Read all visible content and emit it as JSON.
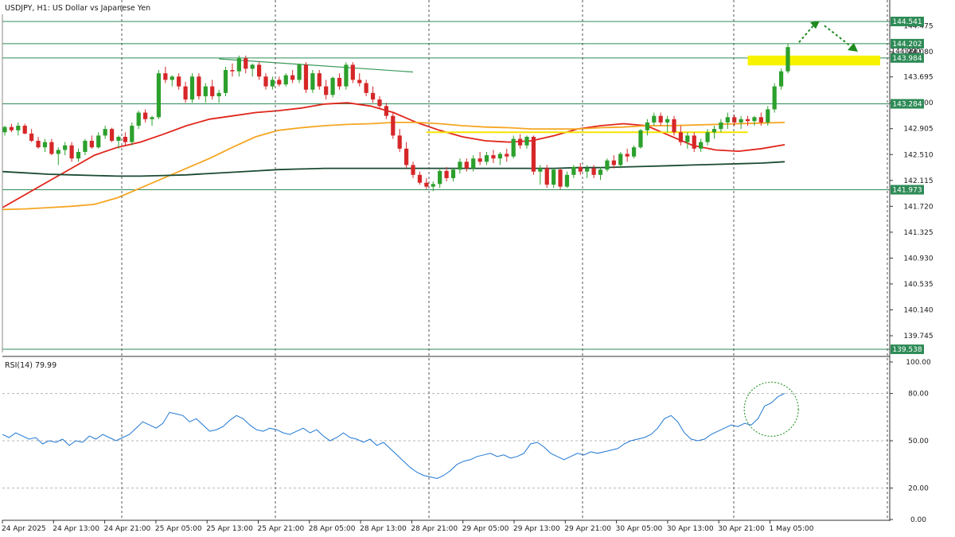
{
  "chart_title": "USDJPY, H1:  US Dollar vs Japanese Yen",
  "rsi_title": "RSI(14) 79.99",
  "colors": {
    "bull": "#2ca02c",
    "bear": "#d62728",
    "ma_red": "#e0251b",
    "ma_orange": "#f5a623",
    "ma_dark": "#1b4a33",
    "level_line": "#2e8b57",
    "highlight": "#f7f300",
    "rsi_line": "#1f77d4",
    "arrow": "#1e8a1e",
    "grid": "#555555"
  },
  "chart_data": {
    "type": "candlestick",
    "price_axis": {
      "ticks": [
        "144.475",
        "144.080",
        "143.695",
        "143.300",
        "142.905",
        "142.510",
        "142.115",
        "141.720",
        "141.325",
        "140.930",
        "140.535",
        "140.140",
        "139.745"
      ],
      "range": [
        139.49,
        144.65
      ]
    },
    "time_axis": {
      "ticks": [
        "24 Apr 2025",
        "24 Apr 13:00",
        "24 Apr 21:00",
        "25 Apr 05:00",
        "25 Apr 13:00",
        "25 Apr 21:00",
        "28 Apr 05:00",
        "28 Apr 13:00",
        "28 Apr 21:00",
        "29 Apr 05:00",
        "29 Apr 13:00",
        "29 Apr 21:00",
        "30 Apr 05:00",
        "30 Apr 13:00",
        "30 Apr 21:00",
        "1 May 05:00"
      ]
    },
    "horizontal_levels": [
      {
        "value": 144.541,
        "label": "144.541"
      },
      {
        "value": 144.202,
        "label": "144.202"
      },
      {
        "value": 143.984,
        "label": "143.984"
      },
      {
        "value": 143.284,
        "label": "143.284"
      },
      {
        "value": 141.973,
        "label": "141.973"
      },
      {
        "value": 139.538,
        "label": "139.538"
      }
    ],
    "extra_price_label": "144.090",
    "candles": [
      [
        142.85,
        142.95,
        142.8,
        142.93
      ],
      [
        142.93,
        142.98,
        142.85,
        142.88
      ],
      [
        142.88,
        143.0,
        142.8,
        142.95
      ],
      [
        142.95,
        142.98,
        142.82,
        142.83
      ],
      [
        142.83,
        142.9,
        142.7,
        142.72
      ],
      [
        142.72,
        142.78,
        142.6,
        142.62
      ],
      [
        142.62,
        142.75,
        142.55,
        142.7
      ],
      [
        142.7,
        142.75,
        142.5,
        142.52
      ],
      [
        142.52,
        142.62,
        142.35,
        142.58
      ],
      [
        142.58,
        142.7,
        142.5,
        142.65
      ],
      [
        142.65,
        142.7,
        142.4,
        142.45
      ],
      [
        142.45,
        142.6,
        142.4,
        142.55
      ],
      [
        142.55,
        142.75,
        142.5,
        142.72
      ],
      [
        142.72,
        142.8,
        142.6,
        142.62
      ],
      [
        142.62,
        142.85,
        142.6,
        142.8
      ],
      [
        142.8,
        142.95,
        142.75,
        142.9
      ],
      [
        142.9,
        142.92,
        142.7,
        142.72
      ],
      [
        142.72,
        142.8,
        142.6,
        142.78
      ],
      [
        142.78,
        142.85,
        142.65,
        142.7
      ],
      [
        142.7,
        143.0,
        142.65,
        142.95
      ],
      [
        142.95,
        143.18,
        142.9,
        143.15
      ],
      [
        143.15,
        143.2,
        143.0,
        143.05
      ],
      [
        143.05,
        143.1,
        142.95,
        143.08
      ],
      [
        143.08,
        143.8,
        143.05,
        143.75
      ],
      [
        143.75,
        143.85,
        143.6,
        143.65
      ],
      [
        143.65,
        143.72,
        143.55,
        143.7
      ],
      [
        143.7,
        143.75,
        143.5,
        143.55
      ],
      [
        143.55,
        143.62,
        143.3,
        143.35
      ],
      [
        143.35,
        143.75,
        143.3,
        143.7
      ],
      [
        143.7,
        143.75,
        143.35,
        143.4
      ],
      [
        143.4,
        143.6,
        143.3,
        143.55
      ],
      [
        143.55,
        143.65,
        143.35,
        143.4
      ],
      [
        143.4,
        143.5,
        143.3,
        143.45
      ],
      [
        143.45,
        143.85,
        143.4,
        143.8
      ],
      [
        143.8,
        143.9,
        143.7,
        143.78
      ],
      [
        143.78,
        144.02,
        143.7,
        143.98
      ],
      [
        143.98,
        144.02,
        143.75,
        143.82
      ],
      [
        143.82,
        143.9,
        143.7,
        143.88
      ],
      [
        143.88,
        143.92,
        143.65,
        143.7
      ],
      [
        143.7,
        143.75,
        143.5,
        143.55
      ],
      [
        143.55,
        143.7,
        143.5,
        143.65
      ],
      [
        143.65,
        143.7,
        143.55,
        143.58
      ],
      [
        143.58,
        143.75,
        143.55,
        143.72
      ],
      [
        143.72,
        143.8,
        143.6,
        143.65
      ],
      [
        143.65,
        143.9,
        143.6,
        143.88
      ],
      [
        143.88,
        143.92,
        143.45,
        143.5
      ],
      [
        143.5,
        143.8,
        143.45,
        143.75
      ],
      [
        143.75,
        143.8,
        143.5,
        143.55
      ],
      [
        143.55,
        143.65,
        143.35,
        143.42
      ],
      [
        143.42,
        143.7,
        143.38,
        143.68
      ],
      [
        143.68,
        143.75,
        143.5,
        143.55
      ],
      [
        143.55,
        143.92,
        143.5,
        143.88
      ],
      [
        143.88,
        143.92,
        143.6,
        143.65
      ],
      [
        143.65,
        143.75,
        143.55,
        143.6
      ],
      [
        143.6,
        143.65,
        143.4,
        143.45
      ],
      [
        143.45,
        143.55,
        143.3,
        143.35
      ],
      [
        143.35,
        143.4,
        143.2,
        143.25
      ],
      [
        143.25,
        143.3,
        143.05,
        143.1
      ],
      [
        143.1,
        143.15,
        142.75,
        142.8
      ],
      [
        142.8,
        142.9,
        142.55,
        142.6
      ],
      [
        142.6,
        142.7,
        142.3,
        142.35
      ],
      [
        142.35,
        142.4,
        142.15,
        142.2
      ],
      [
        142.2,
        142.25,
        142.05,
        142.08
      ],
      [
        142.08,
        142.15,
        141.98,
        142.02
      ],
      [
        142.02,
        142.1,
        141.95,
        142.06
      ],
      [
        142.06,
        142.3,
        142.0,
        142.26
      ],
      [
        142.26,
        142.32,
        142.1,
        142.15
      ],
      [
        142.15,
        142.3,
        142.1,
        142.28
      ],
      [
        142.28,
        142.45,
        142.22,
        142.4
      ],
      [
        142.4,
        142.45,
        142.25,
        142.3
      ],
      [
        142.3,
        142.5,
        142.25,
        142.45
      ],
      [
        142.45,
        142.55,
        142.35,
        142.4
      ],
      [
        142.4,
        142.55,
        142.35,
        142.5
      ],
      [
        142.5,
        142.58,
        142.38,
        142.45
      ],
      [
        142.45,
        142.55,
        142.35,
        142.52
      ],
      [
        142.52,
        142.6,
        142.4,
        142.48
      ],
      [
        142.48,
        142.8,
        142.45,
        142.75
      ],
      [
        142.75,
        142.82,
        142.6,
        142.65
      ],
      [
        142.65,
        142.8,
        142.6,
        142.78
      ],
      [
        142.78,
        142.8,
        142.2,
        142.25
      ],
      [
        142.25,
        142.35,
        142.05,
        142.3
      ],
      [
        142.3,
        142.35,
        142.0,
        142.05
      ],
      [
        142.05,
        142.3,
        142.0,
        142.28
      ],
      [
        142.28,
        142.3,
        141.98,
        142.02
      ],
      [
        142.02,
        142.25,
        142.0,
        142.2
      ],
      [
        142.2,
        142.35,
        142.15,
        142.32
      ],
      [
        142.32,
        142.38,
        142.2,
        142.25
      ],
      [
        142.25,
        142.35,
        142.15,
        142.3
      ],
      [
        142.3,
        142.35,
        142.15,
        142.2
      ],
      [
        142.2,
        142.32,
        142.12,
        142.28
      ],
      [
        142.28,
        142.45,
        142.25,
        142.42
      ],
      [
        142.42,
        142.5,
        142.3,
        142.35
      ],
      [
        142.35,
        142.55,
        142.3,
        142.52
      ],
      [
        142.52,
        142.6,
        142.4,
        142.48
      ],
      [
        142.48,
        142.65,
        142.45,
        142.62
      ],
      [
        142.62,
        142.9,
        142.6,
        142.88
      ],
      [
        142.88,
        143.05,
        142.8,
        143.0
      ],
      [
        143.0,
        143.15,
        142.95,
        143.1
      ],
      [
        143.1,
        143.15,
        142.95,
        143.0
      ],
      [
        143.0,
        143.1,
        142.85,
        143.05
      ],
      [
        143.05,
        143.1,
        142.8,
        142.85
      ],
      [
        142.85,
        142.95,
        142.65,
        142.7
      ],
      [
        142.7,
        142.85,
        142.6,
        142.8
      ],
      [
        142.8,
        142.85,
        142.55,
        142.6
      ],
      [
        142.6,
        142.75,
        142.55,
        142.7
      ],
      [
        142.7,
        142.9,
        142.65,
        142.85
      ],
      [
        142.85,
        142.95,
        142.75,
        142.9
      ],
      [
        142.9,
        143.05,
        142.85,
        143.0
      ],
      [
        143.0,
        143.15,
        142.9,
        143.08
      ],
      [
        143.08,
        143.12,
        142.95,
        143.0
      ],
      [
        143.0,
        143.1,
        142.9,
        143.05
      ],
      [
        143.05,
        143.1,
        142.95,
        143.02
      ],
      [
        143.02,
        143.1,
        142.95,
        143.08
      ],
      [
        143.08,
        143.15,
        142.95,
        143.0
      ],
      [
        143.0,
        143.25,
        142.95,
        143.2
      ],
      [
        143.2,
        143.6,
        143.15,
        143.55
      ],
      [
        143.55,
        143.82,
        143.5,
        143.78
      ],
      [
        143.78,
        144.2,
        143.75,
        144.15
      ]
    ],
    "moving_averages": [
      {
        "color_key": "ma_red",
        "values": [
          141.7,
          141.9,
          142.1,
          142.3,
          142.5,
          142.62,
          142.7,
          142.82,
          142.95,
          143.05,
          143.1,
          143.15,
          143.18,
          143.22,
          143.28,
          143.3,
          143.25,
          143.15,
          143.0,
          142.88,
          142.78,
          142.72,
          142.7,
          142.72,
          142.8,
          142.9,
          142.95,
          142.98,
          142.95,
          142.8,
          142.65,
          142.58,
          142.56,
          142.6,
          142.66
        ]
      },
      {
        "color_key": "ma_orange",
        "values": [
          141.67,
          141.68,
          141.7,
          141.72,
          141.75,
          141.85,
          142.0,
          142.15,
          142.3,
          142.45,
          142.62,
          142.78,
          142.88,
          142.92,
          142.95,
          142.97,
          142.98,
          143.0,
          143.0,
          142.98,
          142.95,
          142.93,
          142.92,
          142.9,
          142.9,
          142.9,
          142.92,
          142.93,
          142.95,
          142.95,
          142.96,
          142.97,
          142.98,
          142.99,
          143.0
        ]
      },
      {
        "color_key": "ma_dark",
        "values": [
          142.25,
          142.23,
          142.21,
          142.2,
          142.19,
          142.18,
          142.18,
          142.19,
          142.2,
          142.22,
          142.24,
          142.26,
          142.28,
          142.29,
          142.3,
          142.3,
          142.3,
          142.3,
          142.3,
          142.3,
          142.3,
          142.3,
          142.3,
          142.3,
          142.3,
          142.31,
          142.31,
          142.32,
          142.33,
          142.34,
          142.35,
          142.36,
          142.37,
          142.38,
          142.4
        ]
      }
    ],
    "trendlines": [
      {
        "color_key": "ma_dark",
        "from": [
          32,
          143.97
        ],
        "to": [
          61,
          143.77
        ]
      },
      {
        "color_key": "highlight",
        "from": [
          63,
          142.85
        ],
        "to": [
          111,
          142.85
        ]
      }
    ],
    "rsi": {
      "title": "RSI(14) 79.99",
      "ticks": [
        "100.00",
        "80.00",
        "50.00",
        "20.00",
        "0.00"
      ],
      "range": [
        0,
        100
      ],
      "levels": [
        80,
        50,
        20
      ],
      "values": [
        54,
        52,
        55,
        53,
        51,
        52,
        48,
        50,
        49,
        51,
        47,
        50,
        49,
        53,
        51,
        54,
        52,
        50,
        52,
        54,
        58,
        62,
        60,
        58,
        61,
        68,
        67,
        66,
        62,
        64,
        60,
        56,
        57,
        59,
        63,
        66,
        64,
        60,
        57,
        56,
        58,
        57,
        55,
        54,
        56,
        58,
        55,
        57,
        53,
        50,
        52,
        55,
        52,
        51,
        49,
        51,
        47,
        49,
        45,
        41,
        37,
        33,
        30,
        28,
        27,
        26,
        28,
        31,
        35,
        37,
        38,
        40,
        41,
        42,
        40,
        41,
        39,
        40,
        42,
        48,
        49,
        46,
        42,
        40,
        38,
        40,
        42,
        41,
        43,
        42,
        43,
        44,
        45,
        48,
        50,
        51,
        52,
        54,
        58,
        64,
        66,
        62,
        55,
        51,
        50,
        51,
        54,
        56,
        58,
        60,
        59,
        61,
        60,
        64,
        72,
        74,
        78,
        80
      ],
      "final_value": 79.99
    }
  }
}
